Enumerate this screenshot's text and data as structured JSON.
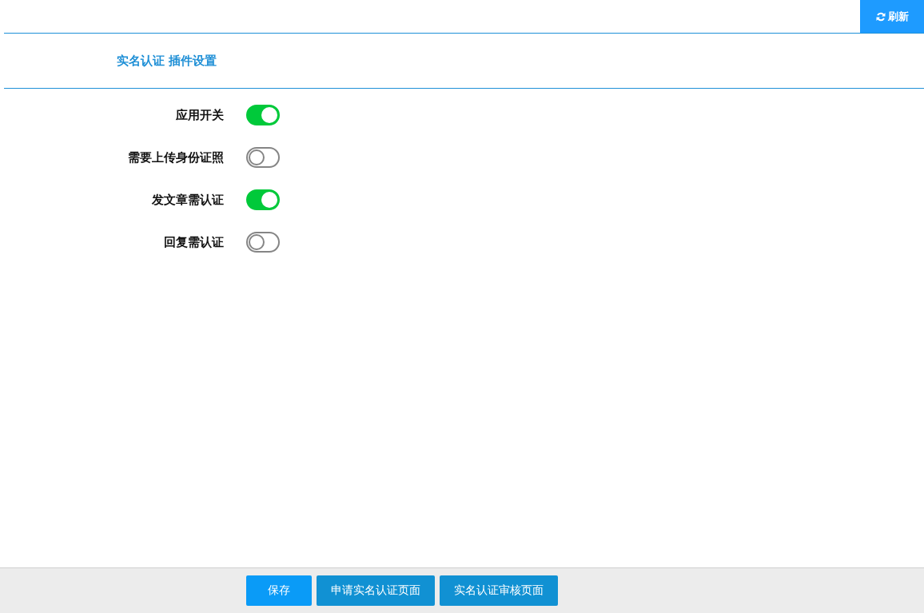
{
  "toolbar": {
    "refresh_button": "刷新"
  },
  "section_title": "实名认证 插件设置",
  "settings": [
    {
      "label": "应用开关",
      "on": true
    },
    {
      "label": "需要上传身份证照",
      "on": false
    },
    {
      "label": "发文章需认证",
      "on": true
    },
    {
      "label": "回复需认证",
      "on": false
    }
  ],
  "footer_buttons": [
    {
      "label": "保存",
      "kind": "primary"
    },
    {
      "label": "申请实名认证页面",
      "kind": "secondary"
    },
    {
      "label": "实名认证审核页面",
      "kind": "secondary"
    }
  ]
}
